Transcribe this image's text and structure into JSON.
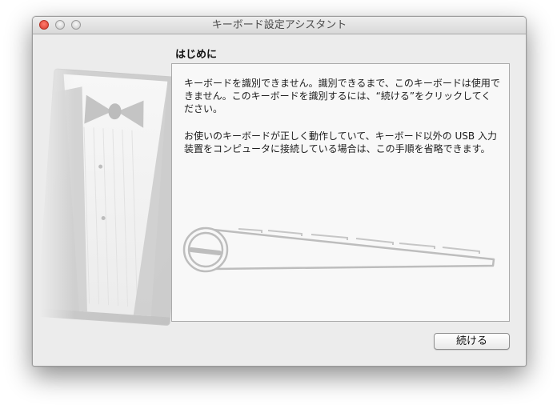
{
  "window": {
    "title": "キーボード設定アシスタント",
    "controls": {
      "close": "close-button",
      "minimize": "minimize-button",
      "zoom": "zoom-button"
    }
  },
  "page": {
    "heading": "はじめに",
    "paragraph_1": "キーボードを識別できません。識別できるまで、このキーボードは使用できません。このキーボードを識別するには、“続ける”をクリックしてください。",
    "paragraph_2": "お使いのキーボードが正しく動作していて、キーボード以外の USB 入力装置をコンピュータに接続している場合は、この手順を省略できます。"
  },
  "footer": {
    "continue_label": "続ける"
  },
  "icons": {
    "illustration": "tuxedo-bowtie-illustration",
    "keyboard": "keyboard-illustration"
  },
  "colors": {
    "window_bg": "#ececec",
    "content_bg": "#f8f8f8",
    "close_red": "#e0443e"
  }
}
